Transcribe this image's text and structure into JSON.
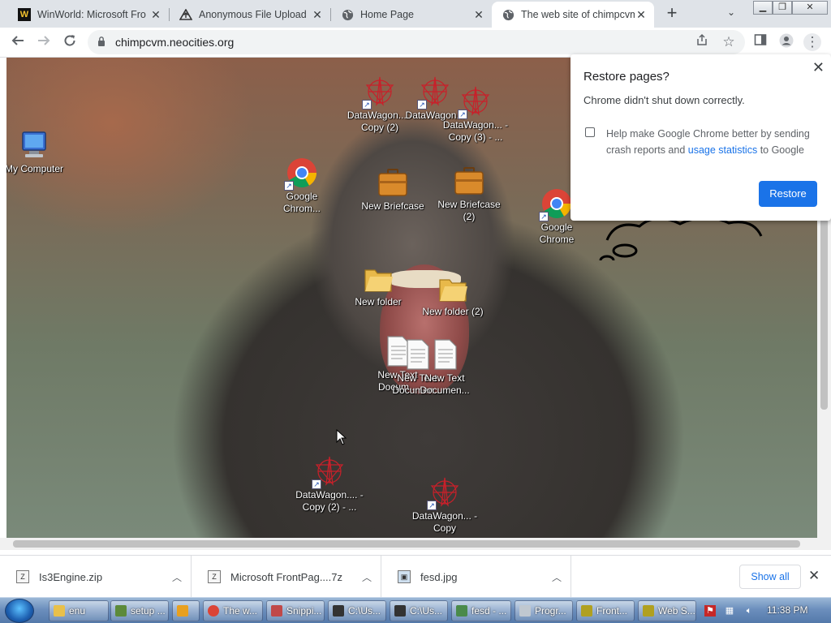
{
  "tabs": [
    {
      "title": "WinWorld: Microsoft Fro",
      "icon": "winworld-icon",
      "active": false
    },
    {
      "title": "Anonymous File Upload",
      "icon": "upload-icon",
      "active": false
    },
    {
      "title": "Home Page",
      "icon": "globe-icon",
      "active": false
    },
    {
      "title": "The web site of chimpcvm",
      "icon": "globe-icon",
      "active": true
    }
  ],
  "toolbar": {
    "url": "chimpcvm.neocities.org"
  },
  "desktop": {
    "icons": [
      {
        "label": "My Computer",
        "kind": "computer"
      },
      {
        "label": "Google Chrom...",
        "kind": "chrome"
      },
      {
        "label": "DataWagon... - Copy (2)",
        "kind": "datawagon"
      },
      {
        "label": "DataWagon...",
        "kind": "datawagon"
      },
      {
        "label": "DataWagon... - Copy (3) - ...",
        "kind": "datawagon"
      },
      {
        "label": "New Briefcase",
        "kind": "briefcase"
      },
      {
        "label": "New Briefcase (2)",
        "kind": "briefcase"
      },
      {
        "label": "Google Chrome",
        "kind": "chrome"
      },
      {
        "label": "New folder",
        "kind": "folder"
      },
      {
        "label": "New folder (2)",
        "kind": "folder"
      },
      {
        "label": "New Text Docum...",
        "kind": "textdoc"
      },
      {
        "label": "New Text Documen...",
        "kind": "textdoc"
      },
      {
        "label": "New Text Documen...",
        "kind": "textdoc"
      },
      {
        "label": "DataWagon.... - Copy (2) - ...",
        "kind": "datawagon"
      },
      {
        "label": "DataWagon... - Copy",
        "kind": "datawagon"
      }
    ]
  },
  "restore_popup": {
    "title": "Restore pages?",
    "message": "Chrome didn't shut down correctly.",
    "checkbox_text_before": "Help make Google Chrome better by sending crash reports and ",
    "checkbox_link": "usage statistics",
    "checkbox_text_after": " to Google",
    "button": "Restore"
  },
  "downloads": [
    {
      "name": "Is3Engine.zip"
    },
    {
      "name": "Microsoft FrontPag....7z"
    },
    {
      "name": "fesd.jpg"
    }
  ],
  "download_bar": {
    "show_all": "Show all"
  },
  "taskbar": {
    "items": [
      {
        "label": "enu",
        "color": "#e8c04a"
      },
      {
        "label": "setup ...",
        "color": "#5c8a3a"
      },
      {
        "label": "",
        "color": "#e8a020"
      },
      {
        "label": "The w...",
        "color": "#db4437"
      },
      {
        "label": "Snippi...",
        "color": "#c04848"
      },
      {
        "label": "C:\\Us...",
        "color": "#333333"
      },
      {
        "label": "C:\\Us...",
        "color": "#333333"
      },
      {
        "label": "fesd - ...",
        "color": "#4a8a4a"
      },
      {
        "label": "Progr...",
        "color": "#c0c8d0"
      },
      {
        "label": "Front...",
        "color": "#b0a020"
      },
      {
        "label": "Web S...",
        "color": "#b0a020"
      }
    ],
    "clock": "11:38 PM"
  },
  "colors": {
    "accent": "#1a73e8",
    "tab_strip": "#dfe3e8"
  }
}
